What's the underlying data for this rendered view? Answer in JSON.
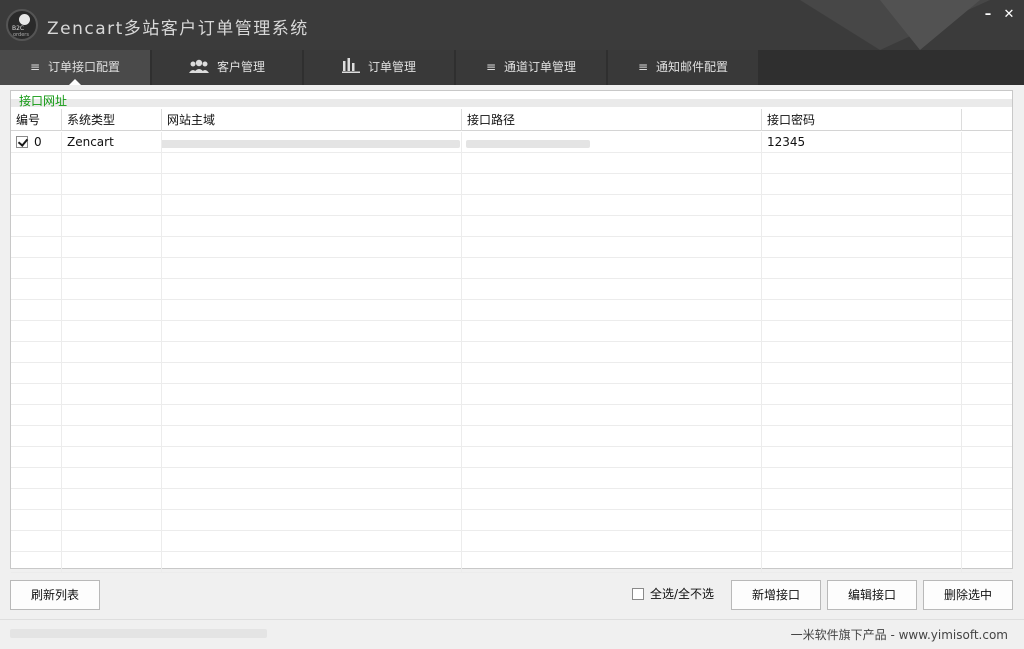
{
  "app": {
    "title": "Zencart多站客户订单管理系统",
    "logo_text_top": "B2C",
    "logo_text_bottom": "orders",
    "minimize": "–",
    "close": "✕"
  },
  "tabs": [
    {
      "label": "订单接口配置",
      "icon": "list-icon",
      "glyph": "≡",
      "active": true
    },
    {
      "label": "客户管理",
      "icon": "users-icon",
      "glyph": "👥",
      "active": false
    },
    {
      "label": "订单管理",
      "icon": "bar-chart-icon",
      "glyph": "",
      "active": false
    },
    {
      "label": "通道订单管理",
      "icon": "list-icon",
      "glyph": "≡",
      "active": false
    },
    {
      "label": "通知邮件配置",
      "icon": "list-icon",
      "glyph": "≡",
      "active": false
    }
  ],
  "group": {
    "title": "接口网址"
  },
  "grid": {
    "columns": [
      "编号",
      "系统类型",
      "网站主域",
      "接口路径",
      "接口密码"
    ],
    "rows": [
      {
        "checked": true,
        "id": "0",
        "system": "Zencart",
        "domain": "",
        "path": "",
        "password": "12345"
      }
    ]
  },
  "footer": {
    "refresh_label": "刷新列表",
    "select_all_label": "全选/全不选",
    "add_label": "新增接口",
    "edit_label": "编辑接口",
    "delete_label": "删除选中"
  },
  "status": {
    "credit": "一米软件旗下产品 - www.yimisoft.com"
  },
  "colors": {
    "titlebar": "#3b3b3b",
    "tab_active": "#4a4a4a",
    "group_title": "#129a12"
  }
}
